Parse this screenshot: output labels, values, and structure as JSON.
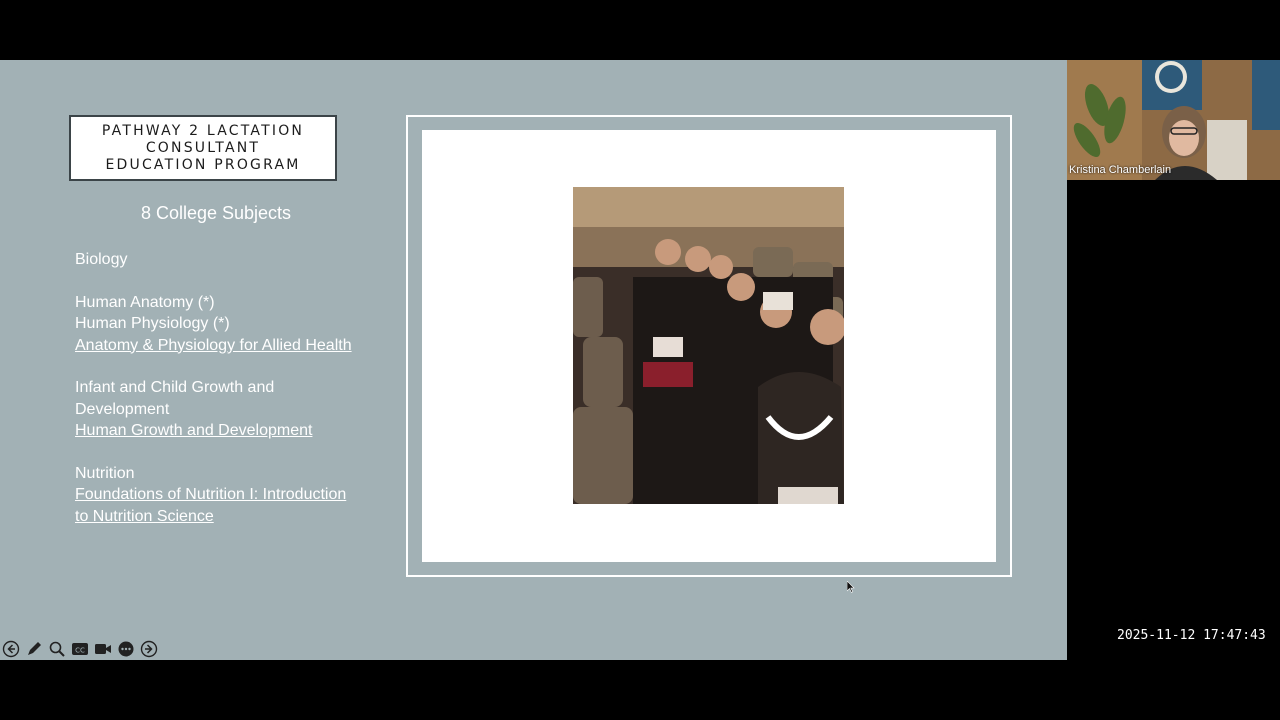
{
  "slide": {
    "title_lines": [
      "PATHWAY 2 LACTATION",
      "CONSULTANT",
      "EDUCATION PROGRAM"
    ],
    "subjects_heading": "8 College Subjects",
    "subjects": {
      "biology": "Biology",
      "anatomy": "Human Anatomy (*)",
      "physiology": "Human Physiology (*)",
      "anatomy_physiology_link": "Anatomy & Physiology for Allied Health",
      "growth_line1": "Infant and Child Growth and",
      "growth_line2": "Development",
      "growth_link": "Human Growth and Development",
      "nutrition": "Nutrition",
      "nutrition_link_line1": "Foundations of Nutrition I: Introduction",
      "nutrition_link_line2": "to Nutrition Science"
    }
  },
  "toolbar": {
    "icons": [
      "back-icon",
      "pen-icon",
      "zoom-icon",
      "captions-icon",
      "camera-icon",
      "more-icon",
      "forward-icon"
    ]
  },
  "webcam": {
    "participant_name": "Kristina Chamberlain"
  },
  "timestamp": "2025-11-12  17:47:43",
  "colors": {
    "slide_background": "#a2b1b5",
    "title_border": "#3b4448"
  }
}
